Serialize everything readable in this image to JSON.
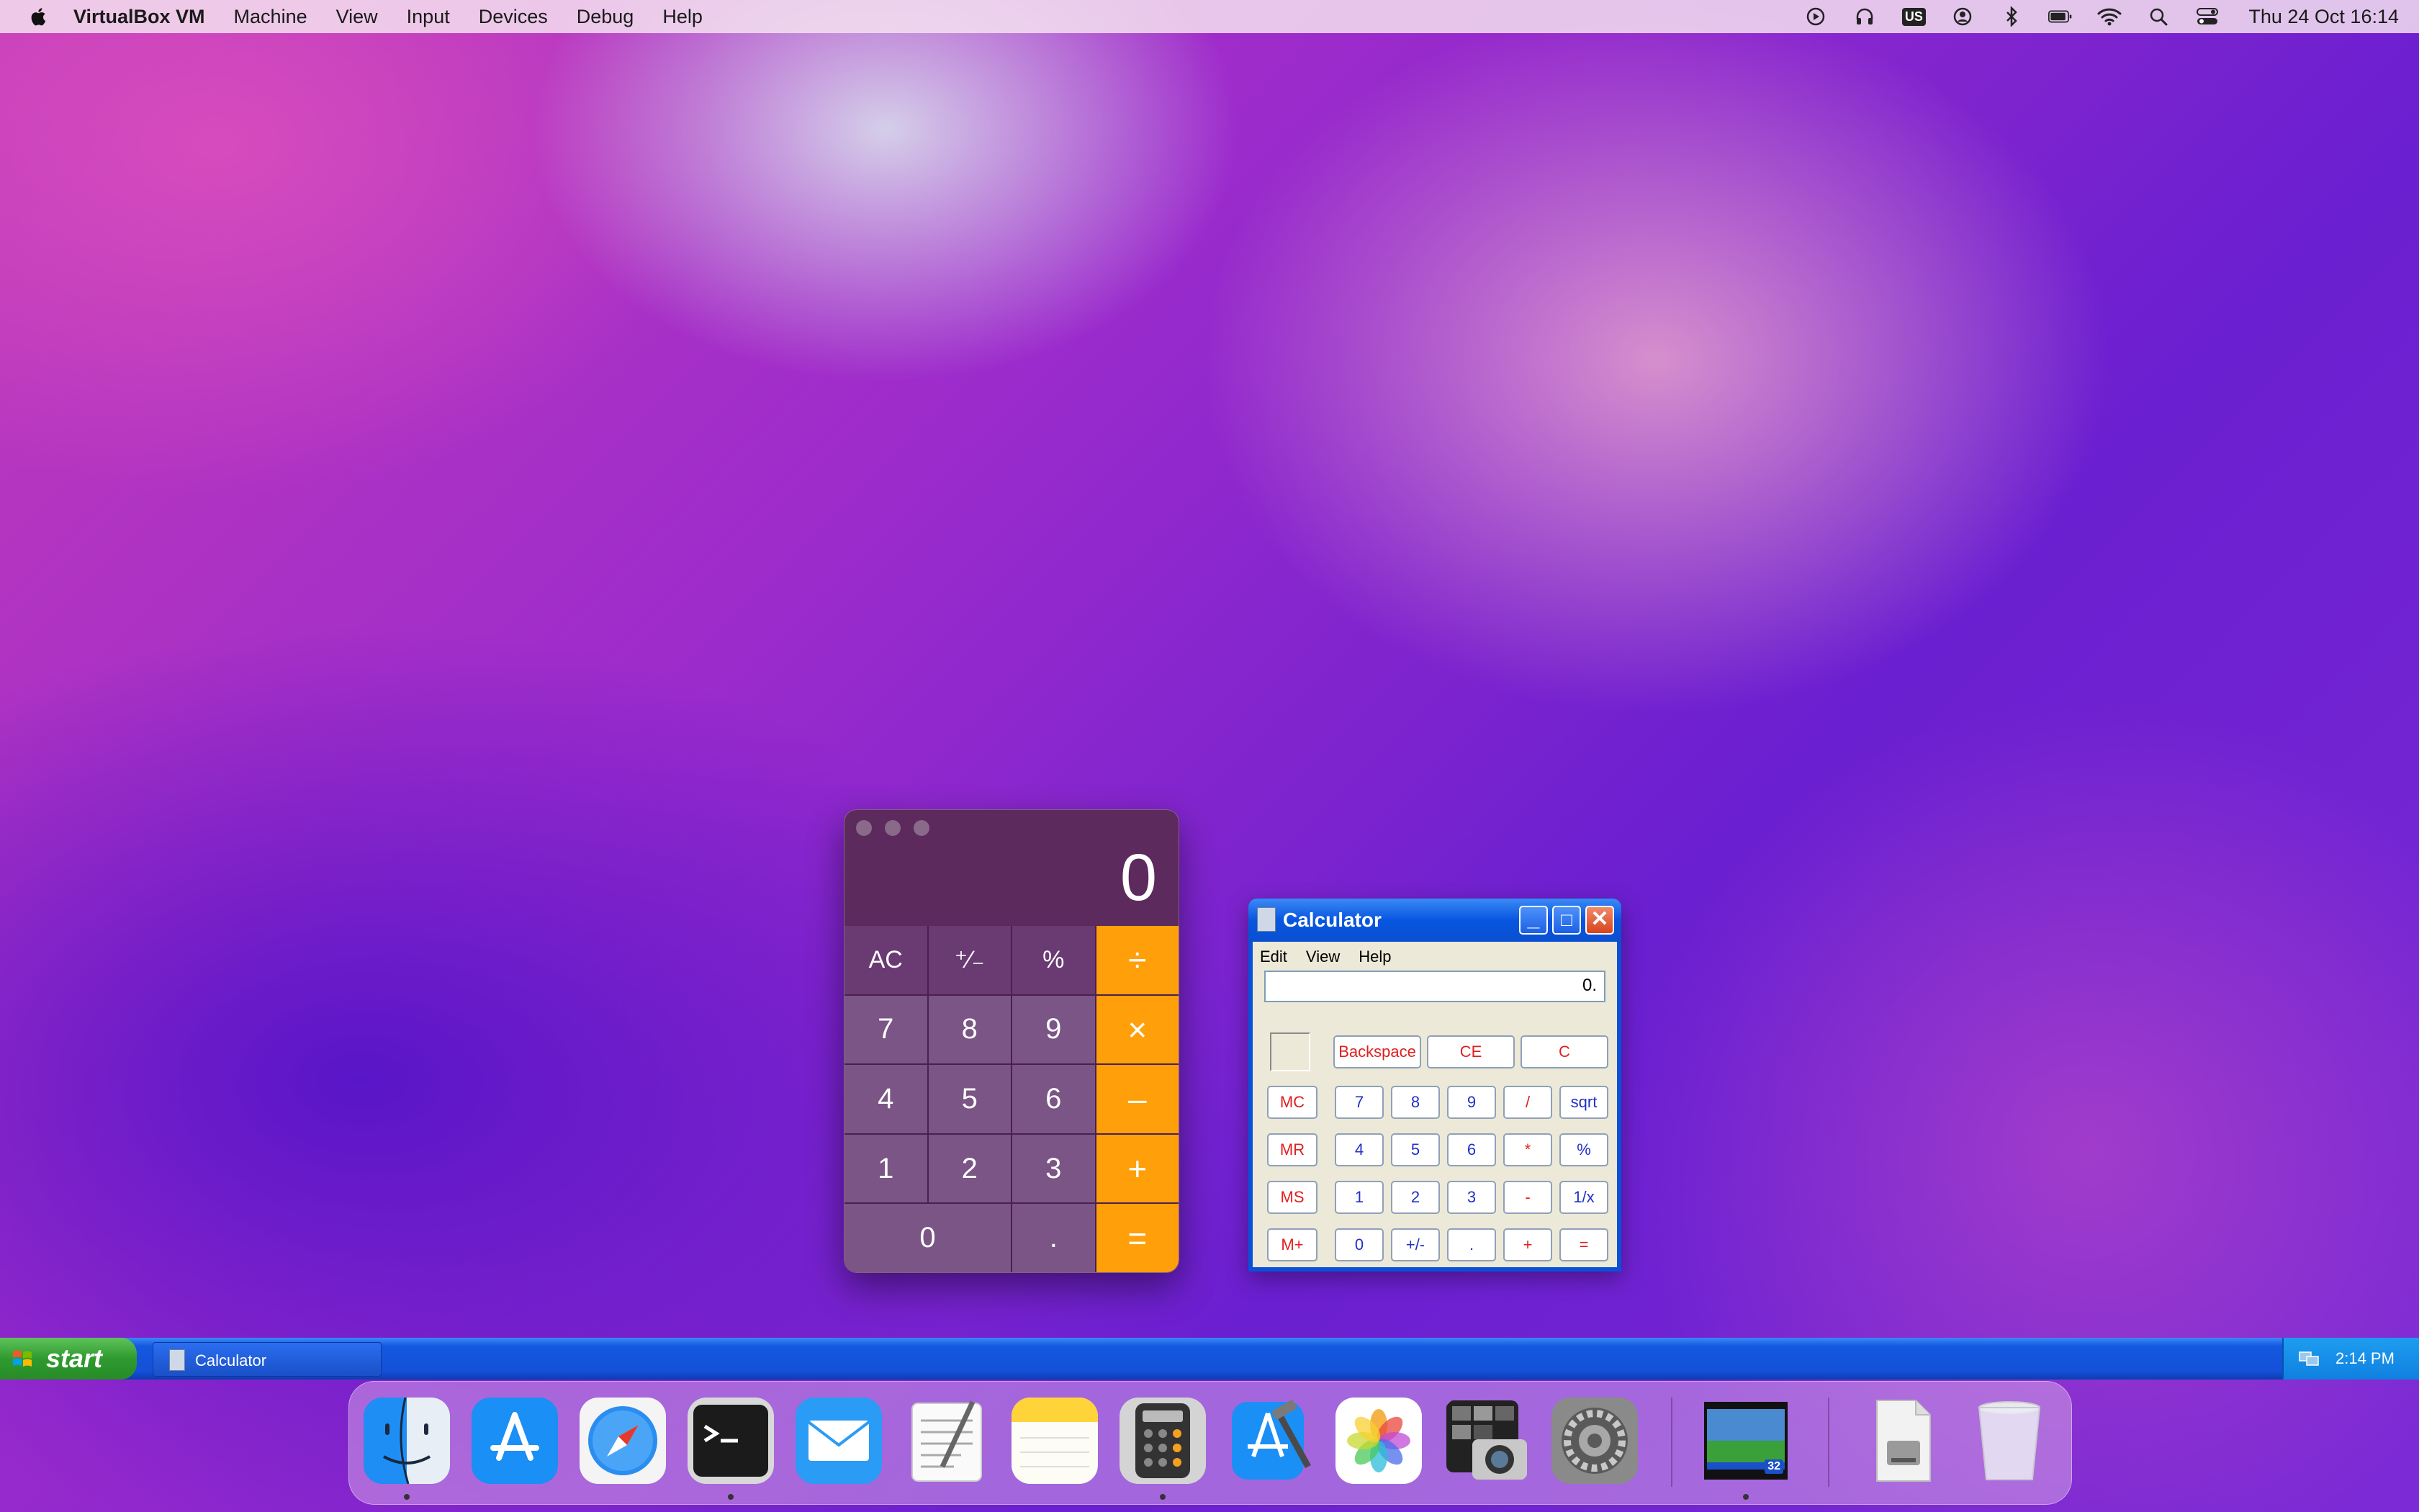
{
  "menubar": {
    "app_name": "VirtualBox VM",
    "items": [
      "Machine",
      "View",
      "Input",
      "Devices",
      "Debug",
      "Help"
    ],
    "keyboard_layout": "US",
    "clock": "Thu 24 Oct  16:14"
  },
  "mac_calculator": {
    "display": "0",
    "keys": {
      "ac": "AC",
      "plus_minus": "⁺∕₋",
      "percent": "%",
      "divide": "÷",
      "seven": "7",
      "eight": "8",
      "nine": "9",
      "multiply": "×",
      "four": "4",
      "five": "5",
      "six": "6",
      "minus": "–",
      "one": "1",
      "two": "2",
      "three": "3",
      "plus": "+",
      "zero": "0",
      "decimal": ".",
      "equals": "="
    },
    "colors": {
      "operator": "#ff9f0a",
      "body": "#5c2a5c"
    }
  },
  "xp_calculator": {
    "title": "Calculator",
    "menu": [
      "Edit",
      "View",
      "Help"
    ],
    "display": "0.",
    "title_buttons": {
      "minimize": "_",
      "maximize": "□",
      "close": "✕"
    },
    "keys": {
      "backspace": "Backspace",
      "ce": "CE",
      "c": "C",
      "mc": "MC",
      "mr": "MR",
      "ms": "MS",
      "mplus": "M+",
      "seven": "7",
      "eight": "8",
      "nine": "9",
      "divide": "/",
      "sqrt": "sqrt",
      "four": "4",
      "five": "5",
      "six": "6",
      "multiply": "*",
      "percent": "%",
      "one": "1",
      "two": "2",
      "three": "3",
      "minus": "-",
      "reciprocal": "1/x",
      "zero": "0",
      "plus_minus": "+/-",
      "decimal": ".",
      "plus": "+",
      "equals": "="
    }
  },
  "xp_taskbar": {
    "start_label": "start",
    "task_label": "Calculator",
    "tray_time": "2:14 PM"
  },
  "dock": {
    "items": [
      "finder-icon",
      "app-store-icon",
      "safari-icon",
      "terminal-icon",
      "mail-icon",
      "textedit-icon",
      "notes-icon",
      "calculator-icon",
      "xcode-icon",
      "photos-icon",
      "image-capture-icon",
      "system-preferences-icon",
      "virtualbox-vm-icon",
      "disk-image-icon",
      "trash-icon"
    ],
    "vm_badge": "32"
  }
}
